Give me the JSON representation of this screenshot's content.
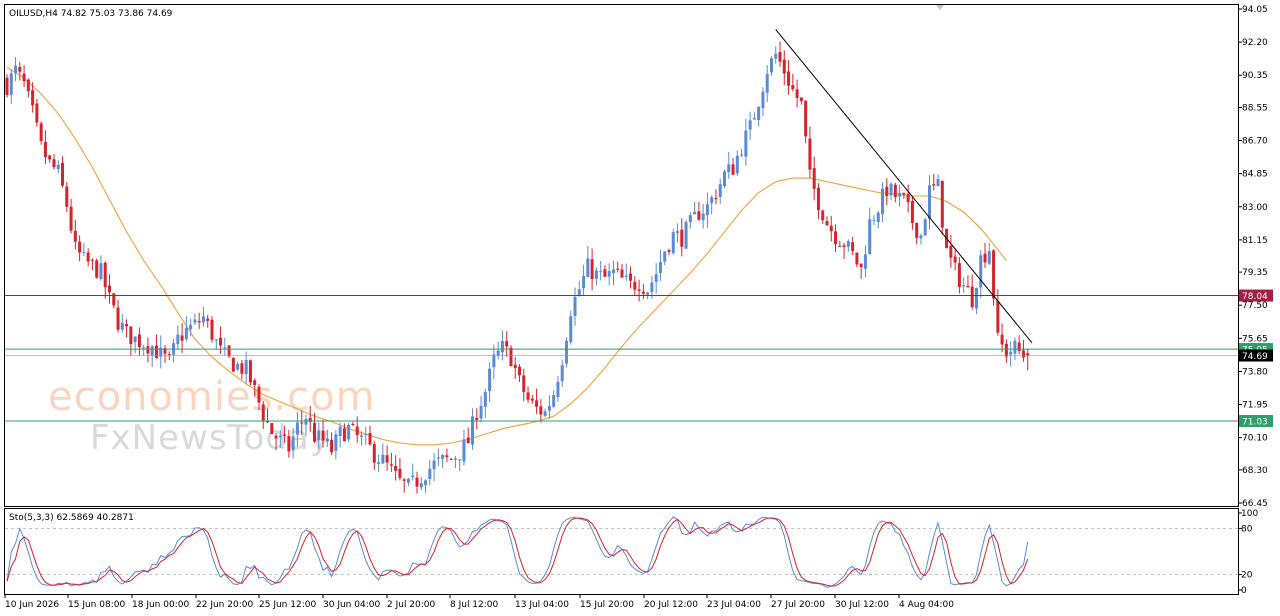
{
  "header": {
    "symbol_line": "OILUSD,H4  74.82 75.03 73.86 74.69",
    "osc_line": "Sto(5,3,3) 62.5869 40.2871"
  },
  "watermark": {
    "line1": "economies.com",
    "line2": "FxNewsToday"
  },
  "colors": {
    "bull": "#5b8bd8",
    "bear": "#d8222c",
    "ma": "#f2a13c",
    "resistance_line": "#a31f46",
    "support_line": "#2f9e6a",
    "trendline": "#000000",
    "sto_main": "#5b8bd8",
    "sto_signal": "#d8222c"
  },
  "chart_data": {
    "type": "candlestick",
    "title": "OILUSD,H4  74.82 75.03 73.86 74.69",
    "ylim": [
      66.45,
      94.05
    ],
    "y_ticks": [
      "94.05",
      "92.20",
      "90.35",
      "88.55",
      "86.70",
      "84.85",
      "83.00",
      "81.15",
      "79.35",
      "77.50",
      "75.65",
      "73.80",
      "71.95",
      "70.10",
      "68.30",
      "66.45"
    ],
    "x_ticks": [
      "10 Jun 2026",
      "15 Jun 08:00",
      "18 Jun 00:00",
      "22 Jun 20:00",
      "25 Jun 12:00",
      "30 Jun 04:00",
      "2 Jul 20:00",
      "8 Jul 12:00",
      "13 Jul 04:00",
      "15 Jul 20:00",
      "20 Jul 12:00",
      "23 Jul 04:00",
      "27 Jul 20:00",
      "30 Jul 12:00",
      "4 Aug 04:00"
    ],
    "close_path": [
      [
        0,
        89.8
      ],
      [
        2,
        90.6
      ],
      [
        4,
        89.8
      ],
      [
        6,
        88.2
      ],
      [
        8,
        86.3
      ],
      [
        10,
        85.4
      ],
      [
        12,
        84.9
      ],
      [
        14,
        83.1
      ],
      [
        16,
        80.6
      ],
      [
        18,
        80.0
      ],
      [
        20,
        79.7
      ],
      [
        22,
        79.3
      ],
      [
        24,
        77.8
      ],
      [
        26,
        76.6
      ],
      [
        28,
        75.9
      ],
      [
        30,
        75.6
      ],
      [
        32,
        75.4
      ],
      [
        34,
        75.2
      ],
      [
        36,
        74.7
      ],
      [
        38,
        74.3
      ],
      [
        40,
        75.6
      ],
      [
        42,
        76.1
      ],
      [
        44,
        76.4
      ],
      [
        46,
        76.8
      ],
      [
        48,
        75.9
      ],
      [
        50,
        74.9
      ],
      [
        52,
        74.4
      ],
      [
        54,
        74.1
      ],
      [
        56,
        73.9
      ],
      [
        58,
        72.7
      ],
      [
        60,
        71.4
      ],
      [
        62,
        70.4
      ],
      [
        64,
        69.9
      ],
      [
        66,
        69.5
      ],
      [
        68,
        70.7
      ],
      [
        70,
        71.3
      ],
      [
        72,
        70.2
      ],
      [
        74,
        69.9
      ],
      [
        76,
        69.4
      ],
      [
        78,
        70.3
      ],
      [
        80,
        70.6
      ],
      [
        82,
        70.1
      ],
      [
        84,
        69.8
      ],
      [
        86,
        69.2
      ],
      [
        88,
        68.8
      ],
      [
        90,
        68.2
      ],
      [
        92,
        67.6
      ],
      [
        94,
        67.3
      ],
      [
        96,
        67.7
      ],
      [
        98,
        68.2
      ],
      [
        100,
        68.6
      ],
      [
        102,
        68.8
      ],
      [
        104,
        68.9
      ],
      [
        106,
        69.3
      ],
      [
        108,
        69.9
      ],
      [
        110,
        71.6
      ],
      [
        112,
        72.7
      ],
      [
        114,
        74.4
      ],
      [
        116,
        75.1
      ],
      [
        118,
        74.6
      ],
      [
        120,
        73.2
      ],
      [
        122,
        72.2
      ],
      [
        124,
        71.7
      ],
      [
        126,
        71.5
      ],
      [
        128,
        72.6
      ],
      [
        130,
        74.6
      ],
      [
        132,
        77.3
      ],
      [
        134,
        78.4
      ],
      [
        136,
        79.6
      ],
      [
        138,
        79.2
      ],
      [
        140,
        79.0
      ],
      [
        142,
        79.3
      ],
      [
        144,
        78.9
      ],
      [
        146,
        78.6
      ],
      [
        148,
        78.8
      ],
      [
        150,
        78.4
      ],
      [
        152,
        79.3
      ],
      [
        154,
        80.6
      ],
      [
        156,
        81.4
      ],
      [
        158,
        81.3
      ],
      [
        160,
        82.0
      ],
      [
        162,
        82.7
      ],
      [
        164,
        83.0
      ],
      [
        166,
        83.8
      ],
      [
        168,
        84.8
      ],
      [
        170,
        85.2
      ],
      [
        172,
        86.4
      ],
      [
        174,
        87.4
      ],
      [
        176,
        89.0
      ],
      [
        178,
        90.7
      ],
      [
        180,
        91.5
      ],
      [
        182,
        90.6
      ],
      [
        184,
        89.5
      ],
      [
        186,
        88.7
      ],
      [
        188,
        84.6
      ],
      [
        190,
        83.3
      ],
      [
        192,
        82.1
      ],
      [
        194,
        81.4
      ],
      [
        196,
        81.0
      ],
      [
        198,
        80.3
      ],
      [
        200,
        79.5
      ],
      [
        202,
        82.1
      ],
      [
        204,
        83.0
      ],
      [
        206,
        84.0
      ],
      [
        208,
        83.6
      ],
      [
        210,
        83.3
      ],
      [
        212,
        82.2
      ],
      [
        214,
        81.4
      ],
      [
        216,
        83.9
      ],
      [
        218,
        84.1
      ],
      [
        220,
        80.5
      ],
      [
        222,
        79.4
      ],
      [
        224,
        78.6
      ],
      [
        226,
        77.9
      ],
      [
        228,
        80.1
      ],
      [
        230,
        80.7
      ],
      [
        232,
        75.5
      ],
      [
        234,
        74.9
      ],
      [
        236,
        75.1
      ],
      [
        238,
        74.7
      ]
    ],
    "moving_average": [
      [
        0,
        90.8
      ],
      [
        4,
        90.2
      ],
      [
        8,
        89.3
      ],
      [
        12,
        88.2
      ],
      [
        16,
        86.8
      ],
      [
        20,
        85.2
      ],
      [
        24,
        83.4
      ],
      [
        28,
        81.6
      ],
      [
        32,
        80.0
      ],
      [
        36,
        78.6
      ],
      [
        40,
        77.1
      ],
      [
        44,
        75.6
      ],
      [
        48,
        74.6
      ],
      [
        52,
        73.8
      ],
      [
        56,
        73.1
      ],
      [
        60,
        72.5
      ],
      [
        64,
        72.1
      ],
      [
        68,
        71.7
      ],
      [
        72,
        71.3
      ],
      [
        76,
        71.0
      ],
      [
        80,
        70.6
      ],
      [
        84,
        70.3
      ],
      [
        88,
        70.0
      ],
      [
        92,
        69.8
      ],
      [
        96,
        69.7
      ],
      [
        100,
        69.7
      ],
      [
        104,
        69.8
      ],
      [
        108,
        70.0
      ],
      [
        112,
        70.3
      ],
      [
        116,
        70.6
      ],
      [
        120,
        70.8
      ],
      [
        124,
        71.0
      ],
      [
        128,
        71.3
      ],
      [
        132,
        72.0
      ],
      [
        136,
        72.9
      ],
      [
        140,
        74.0
      ],
      [
        144,
        75.2
      ],
      [
        148,
        76.3
      ],
      [
        152,
        77.3
      ],
      [
        156,
        78.3
      ],
      [
        160,
        79.3
      ],
      [
        164,
        80.4
      ],
      [
        168,
        81.6
      ],
      [
        172,
        82.8
      ],
      [
        176,
        83.8
      ],
      [
        180,
        84.4
      ],
      [
        184,
        84.6
      ],
      [
        188,
        84.6
      ],
      [
        192,
        84.4
      ],
      [
        196,
        84.2
      ],
      [
        200,
        84.0
      ],
      [
        204,
        83.8
      ],
      [
        208,
        83.7
      ],
      [
        212,
        83.6
      ],
      [
        216,
        83.6
      ],
      [
        220,
        83.3
      ],
      [
        224,
        82.7
      ],
      [
        228,
        81.8
      ],
      [
        232,
        80.6
      ],
      [
        234,
        80.0
      ]
    ],
    "levels": [
      {
        "value": 78.04,
        "label": "78.04",
        "color": "#a31f46"
      },
      {
        "value": 75.05,
        "label": "75.05",
        "color": "#2f9e6a"
      },
      {
        "value": 74.69,
        "label": "74.69",
        "color": "#000000"
      },
      {
        "value": 71.03,
        "label": "71.03",
        "color": "#2f9e6a"
      }
    ],
    "trendline": {
      "from": [
        180,
        92.9
      ],
      "to": [
        240,
        75.4
      ]
    },
    "stochastic": {
      "params": "Sto(5,3,3)",
      "main": 62.5869,
      "signal": 40.2871,
      "ylim": [
        0,
        100
      ],
      "y_ticks": [
        "100",
        "80",
        "20",
        "0"
      ],
      "levels": [
        80,
        20
      ]
    }
  }
}
